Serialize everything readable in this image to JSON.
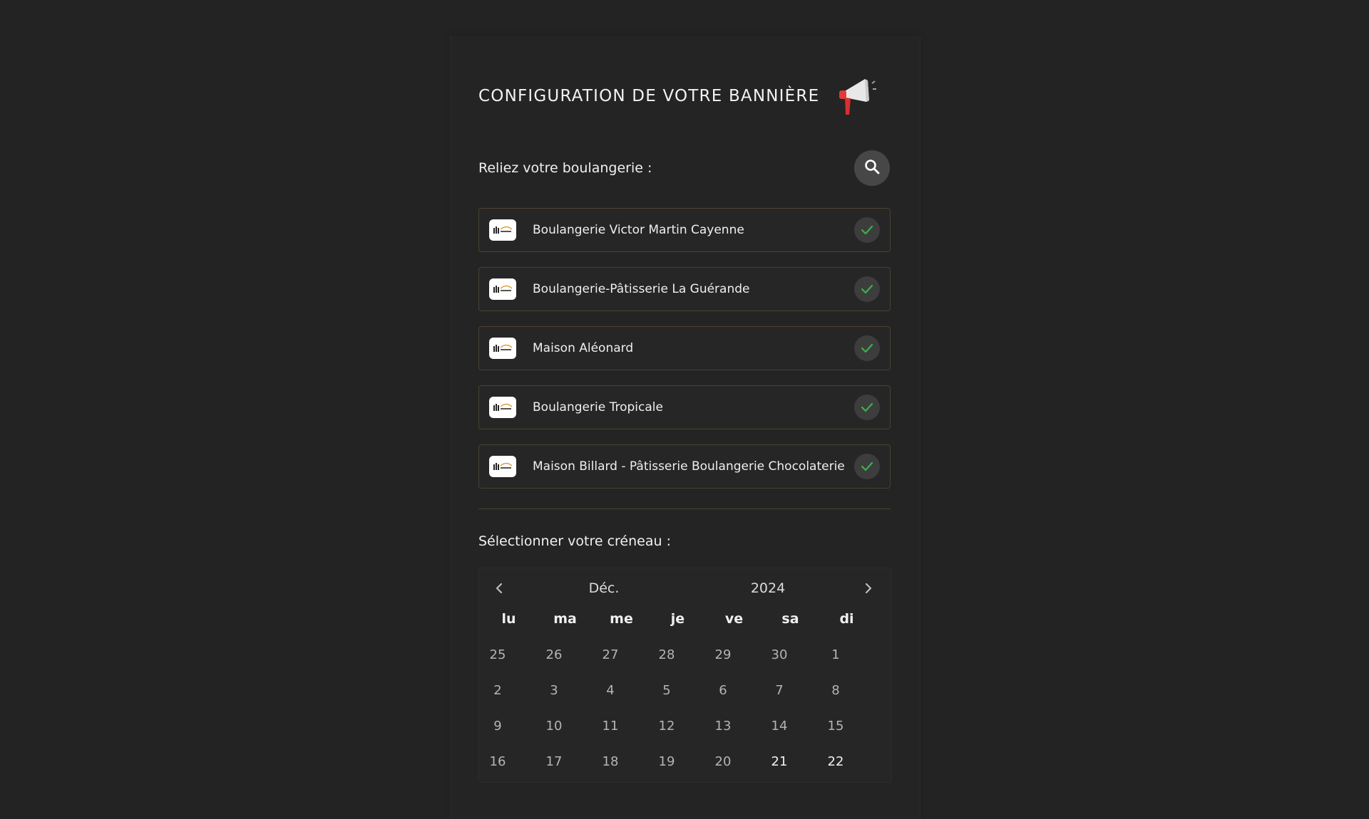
{
  "page": {
    "title": "CONFIGURATION DE VOTRE BANNIÈRE",
    "title_icon": "megaphone-icon"
  },
  "bakery_section": {
    "label": "Reliez votre boulangerie :",
    "search_icon": "search-icon",
    "items": [
      {
        "name": "Boulangerie Victor Martin Cayenne",
        "selected": true
      },
      {
        "name": "Boulangerie-Pâtisserie La Guérande",
        "selected": true
      },
      {
        "name": "Maison Aléonard",
        "selected": true
      },
      {
        "name": "Boulangerie Tropicale",
        "selected": true
      },
      {
        "name": "Maison Billard - Pâtisserie Boulangerie Chocolaterie",
        "selected": true
      }
    ]
  },
  "slot_section": {
    "label": "Sélectionner votre créneau :"
  },
  "calendar": {
    "month": "Déc.",
    "year": "2024",
    "weekdays": [
      "lu",
      "ma",
      "me",
      "je",
      "ve",
      "sa",
      "di"
    ],
    "weeks": [
      [
        "25",
        "26",
        "27",
        "28",
        "29",
        "30",
        "1"
      ],
      [
        "2",
        "3",
        "4",
        "5",
        "6",
        "7",
        "8"
      ],
      [
        "9",
        "10",
        "11",
        "12",
        "13",
        "14",
        "15"
      ],
      [
        "16",
        "17",
        "18",
        "19",
        "20",
        "21",
        "22"
      ]
    ],
    "highlighted_days": [
      "21",
      "22"
    ]
  },
  "colors": {
    "background": "#232323",
    "item_border": "#4a4130",
    "check_green": "#37b24d",
    "search_button": "#474747"
  }
}
